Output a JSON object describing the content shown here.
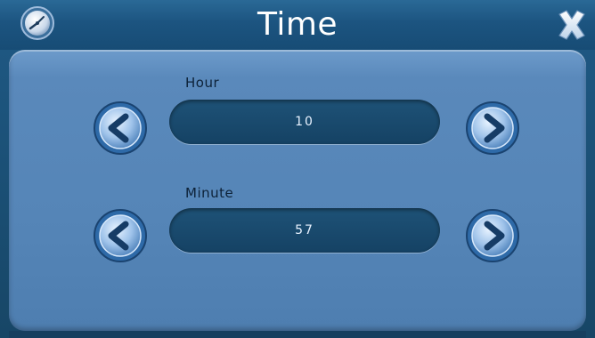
{
  "window": {
    "title": "Time"
  },
  "fields": [
    {
      "label": "Hour",
      "value": "10"
    },
    {
      "label": "Minute",
      "value": "57"
    }
  ],
  "icons": {
    "title": "clock-icon",
    "close": "close-icon",
    "decrement": "chevron-left-icon",
    "increment": "chevron-right-icon"
  },
  "colors": {
    "titlebar": "#1c5480",
    "panel": "#5585b7",
    "value_box": "#1a4b70",
    "value_text": "#e8f2ff",
    "button_ring": "#2e6aa8"
  }
}
